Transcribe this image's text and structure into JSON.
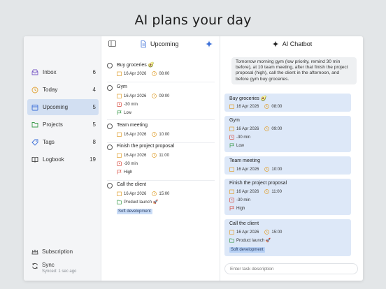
{
  "hero": {
    "title": "AI plans your day"
  },
  "sidebar": {
    "items": [
      {
        "label": "Inbox",
        "count": "6",
        "icon": "inbox-icon"
      },
      {
        "label": "Today",
        "count": "4",
        "icon": "clock-icon"
      },
      {
        "label": "Upcoming",
        "count": "5",
        "icon": "calendar-icon",
        "active": true
      },
      {
        "label": "Projects",
        "count": "5",
        "icon": "folder-icon"
      },
      {
        "label": "Tags",
        "count": "8",
        "icon": "tag-icon"
      },
      {
        "label": "Logbook",
        "count": "19",
        "icon": "book-icon"
      }
    ],
    "subscription": "Subscription",
    "sync": "Sync",
    "sync_status": "Synced: 1 sec ago"
  },
  "upcoming": {
    "title": "Upcoming",
    "tasks": [
      {
        "title": "Buy groceries 🥑",
        "date": "16 Apr 2026",
        "time": "08:00"
      },
      {
        "title": "Gym",
        "date": "16 Apr 2026",
        "time": "09:00",
        "reminder": "-30 min",
        "priority": "Low"
      },
      {
        "title": "Team meeting",
        "date": "16 Apr 2026",
        "time": "10:00"
      },
      {
        "title": "Finish the project proposal",
        "date": "16 Apr 2026",
        "time": "11:00",
        "reminder": "-30 min",
        "priority": "High"
      },
      {
        "title": "Call the client",
        "date": "16 Apr 2026",
        "time": "15:00",
        "project": "Product launch 🚀",
        "tag": "Soft development"
      }
    ]
  },
  "chat": {
    "title": "AI Chatbot",
    "user_message": "Tomorrow morning gym (low priority, remind 30 min before), at 10 team meeting, after that finish the project proposal (high), call the client in the afternoon, and before gym buy groceries.",
    "cards": [
      {
        "title": "Buy groceries 🥑",
        "date": "16 Apr 2026",
        "time": "08:00"
      },
      {
        "title": "Gym",
        "date": "16 Apr 2026",
        "time": "09:00",
        "reminder": "-30 min",
        "priority": "Low"
      },
      {
        "title": "Team meeting",
        "date": "16 Apr 2026",
        "time": "10:00"
      },
      {
        "title": "Finish the project proposal",
        "date": "16 Apr 2026",
        "time": "11:00",
        "reminder": "-30 min",
        "priority": "High"
      },
      {
        "title": "Call the client",
        "date": "16 Apr 2026",
        "time": "15:00",
        "project": "Product launch 🚀",
        "tag": "Soft development"
      }
    ],
    "input_placeholder": "Enter task description"
  },
  "colors": {
    "accent": "#3b6fd8",
    "active_bg": "#d2dff2",
    "card_bg": "#dde8f8",
    "tag_bg": "#c9dcf7",
    "priority_low": "#3a9a4a",
    "priority_high": "#d84b3f",
    "date_icon": "#e0a030",
    "reminder_icon": "#d84b3f",
    "project_icon": "#3a9a4a"
  }
}
